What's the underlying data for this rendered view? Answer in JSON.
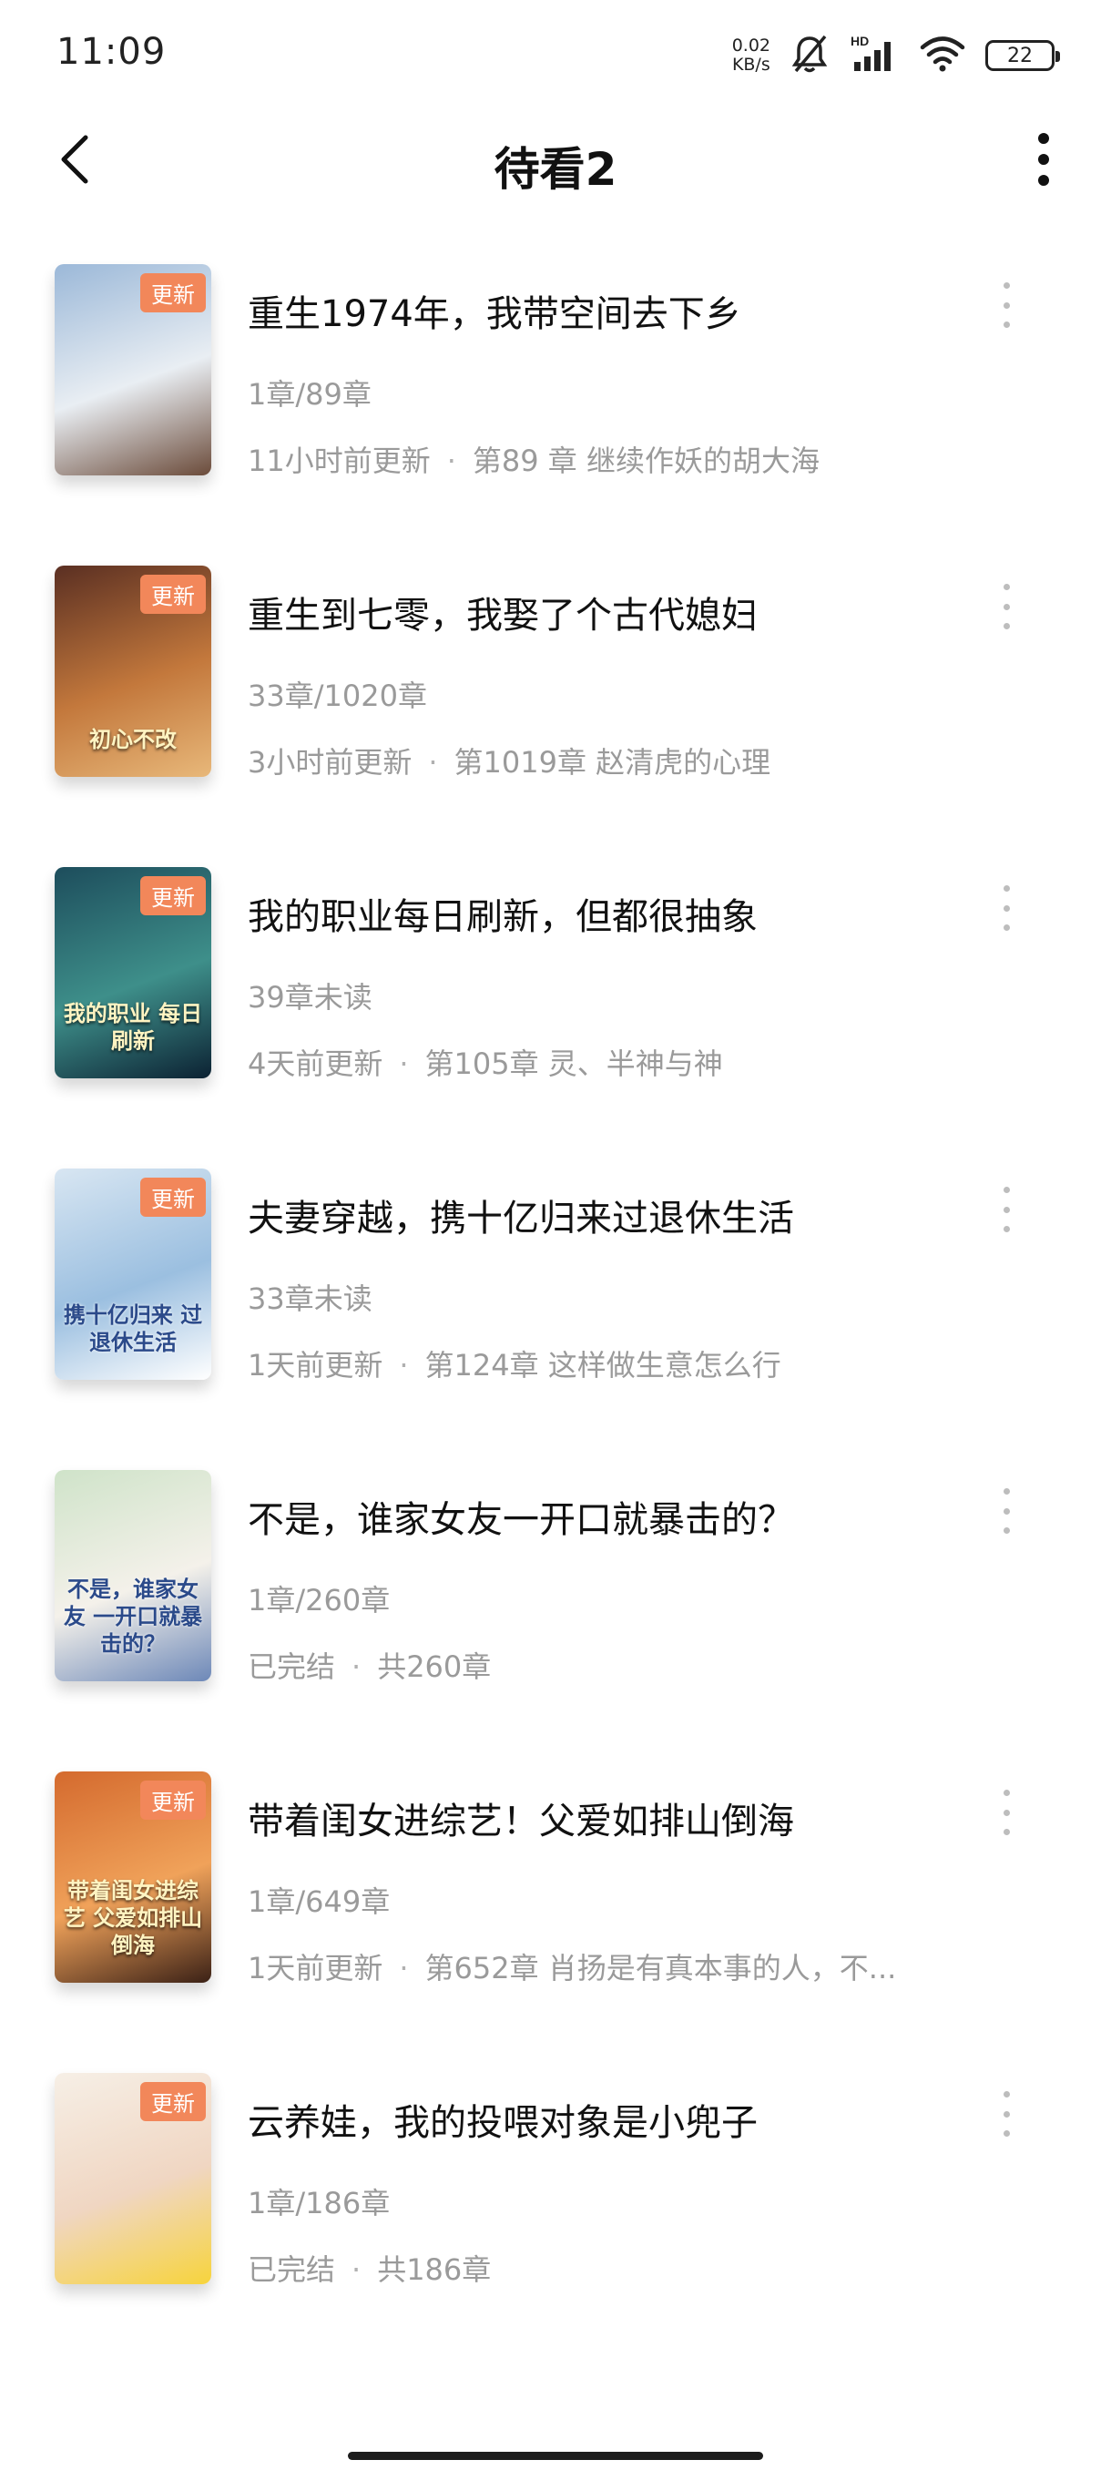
{
  "status_bar": {
    "time": "11:09",
    "net_speed_value": "0.02",
    "net_speed_unit": "KB/s",
    "network_type": "HD",
    "battery": "22"
  },
  "header": {
    "title": "待看2"
  },
  "books": [
    {
      "title": "重生1974年，我带空间去下乡",
      "progress": "1章/89章",
      "updated": "11小时前更新",
      "latest": "第89 章 继续作妖的胡大海",
      "badge": "更新",
      "cover_text": "",
      "cover_colors": [
        "#9bb8d8",
        "#e9eef3",
        "#6b4b3a"
      ]
    },
    {
      "title": "重生到七零，我娶了个古代媳妇",
      "progress": "33章/1020章",
      "updated": "3小时前更新",
      "latest": "第1019章 赵清虎的心理",
      "badge": "更新",
      "cover_text": "初心不改",
      "cover_colors": [
        "#5a2f22",
        "#c3783c",
        "#e8b87a"
      ]
    },
    {
      "title": "我的职业每日刷新，但都很抽象",
      "progress": "39章未读",
      "updated": "4天前更新",
      "latest": "第105章 灵、半神与神",
      "badge": "更新",
      "cover_text": "我的职业 每日刷新",
      "cover_colors": [
        "#1d4d5c",
        "#3e8f8a",
        "#0c2233"
      ]
    },
    {
      "title": "夫妻穿越，携十亿归来过退休生活",
      "progress": "33章未读",
      "updated": "1天前更新",
      "latest": "第124章 这样做生意怎么行",
      "badge": "更新",
      "cover_text": "携十亿归来 过退休生活",
      "cover_colors": [
        "#d8e6f2",
        "#9bbfe0",
        "#ffffff"
      ]
    },
    {
      "title": "不是，谁家女友一开口就暴击的？",
      "progress": "1章/260章",
      "updated": "已完结",
      "latest": "共260章",
      "badge": "",
      "cover_text": "不是，谁家女友 一开口就暴击的？",
      "cover_colors": [
        "#cfe3c9",
        "#f4f1ea",
        "#6d88b8"
      ]
    },
    {
      "title": "带着闺女进综艺！父爱如排山倒海",
      "progress": "1章/649章",
      "updated": "1天前更新",
      "latest": "第652章 肖扬是有真本事的人，不...",
      "badge": "更新",
      "cover_text": "带着闺女进综艺 父爱如排山倒海",
      "cover_colors": [
        "#d46a2e",
        "#f0a25a",
        "#3b2116"
      ]
    },
    {
      "title": "云养娃，我的投喂对象是小兜子",
      "progress": "1章/186章",
      "updated": "已完结",
      "latest": "共186章",
      "badge": "更新",
      "cover_text": "",
      "cover_colors": [
        "#f6efe6",
        "#f0d6c2",
        "#f7d43c"
      ]
    }
  ]
}
